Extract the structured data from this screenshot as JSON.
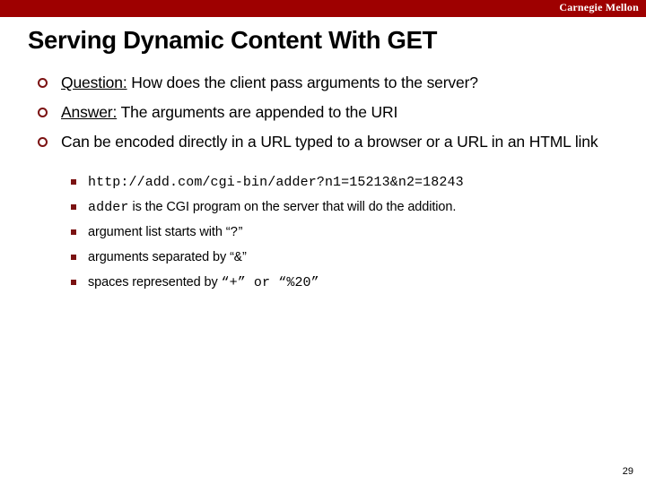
{
  "banner": {
    "brand": "Carnegie Mellon",
    "color": "#9e0000"
  },
  "title": "Serving Dynamic Content With GET",
  "accent_color": "#7b1212",
  "bullets": [
    {
      "lead": "Question:",
      "rest": " How does the client pass arguments to the server?",
      "marker": "hollow-circle"
    },
    {
      "lead": "Answer:",
      "rest": " The arguments are appended to the URI",
      "marker": "hollow-circle"
    },
    {
      "lead": "",
      "rest": "Can be encoded directly in a URL typed to a browser or a URL in an HTML link",
      "marker": "hollow-circle"
    }
  ],
  "sub_bullets": [
    {
      "marker": "filled-square",
      "parts": [
        {
          "text": "http://add.com/cgi-bin/adder?n1=15213&n2=18243",
          "style": "mono"
        }
      ]
    },
    {
      "marker": "filled-square",
      "parts": [
        {
          "text": "adder",
          "style": "mono"
        },
        {
          "text": " is the CGI program on the server that will do the addition.",
          "style": "sans"
        }
      ]
    },
    {
      "marker": "filled-square",
      "parts": [
        {
          "text": "argument list starts with “",
          "style": "sans"
        },
        {
          "text": "?",
          "style": "mono"
        },
        {
          "text": "”",
          "style": "sans"
        }
      ]
    },
    {
      "marker": "filled-square",
      "parts": [
        {
          "text": "arguments separated by “",
          "style": "sans"
        },
        {
          "text": "&",
          "style": "mono"
        },
        {
          "text": "”",
          "style": "sans"
        }
      ]
    },
    {
      "marker": "filled-square",
      "parts": [
        {
          "text": "spaces represented by ",
          "style": "sans"
        },
        {
          "text": "“+” or “%20”",
          "style": "mono"
        }
      ]
    }
  ],
  "page_number": "29"
}
